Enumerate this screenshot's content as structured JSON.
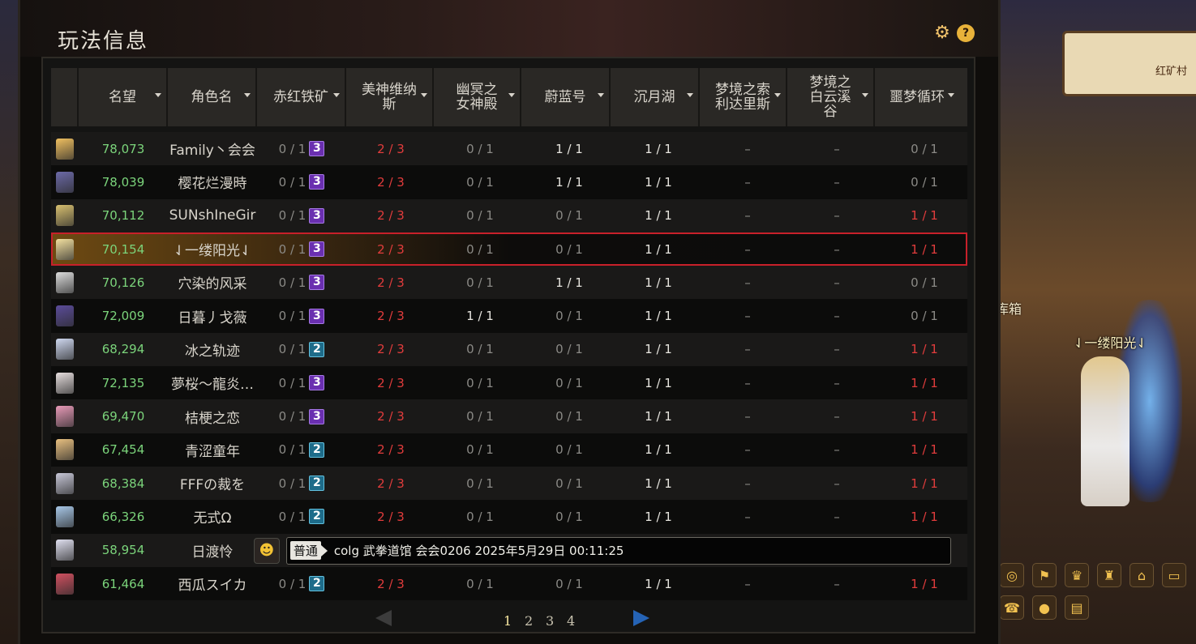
{
  "panel": {
    "title": "玩法信息",
    "settings_icon": "gear-icon",
    "help_icon": "help-icon",
    "help_label": "?"
  },
  "columns": [
    {
      "label": "名望",
      "sortable": true
    },
    {
      "label": "角色名",
      "sortable": true
    },
    {
      "label": "赤红铁矿",
      "sortable": true
    },
    {
      "label": "美神维纳斯",
      "sortable": true
    },
    {
      "label": "幽冥之女神殿",
      "sortable": true
    },
    {
      "label": "蔚蓝号",
      "sortable": true
    },
    {
      "label": "沉月湖",
      "sortable": true
    },
    {
      "label": "梦境之索利达里斯",
      "sortable": true
    },
    {
      "label": "梦境之白云溪谷",
      "sortable": true
    },
    {
      "label": "噩梦循环",
      "sortable": true
    }
  ],
  "rows": [
    {
      "fame": "78,073",
      "name": "Family丶会会",
      "iron": "0 / 1",
      "iron_badge": "3",
      "iron_badge_color": "purple",
      "venus": "2 / 3",
      "nether": "0 / 1",
      "azure": "1 / 1",
      "azure_color": "white",
      "moon": "1 / 1",
      "sol": "–",
      "cloud": "–",
      "nightmare": "0 / 1",
      "nightmare_color": "grey",
      "avatar_color": "#f0c060"
    },
    {
      "fame": "78,039",
      "name": "樱花烂漫時",
      "iron": "0 / 1",
      "iron_badge": "3",
      "iron_badge_color": "purple",
      "venus": "2 / 3",
      "nether": "0 / 1",
      "azure": "1 / 1",
      "azure_color": "white",
      "moon": "1 / 1",
      "sol": "–",
      "cloud": "–",
      "nightmare": "0 / 1",
      "nightmare_color": "grey",
      "avatar_color": "#6c6aa8"
    },
    {
      "fame": "70,112",
      "name": "SUNshΙneGir",
      "iron": "0 / 1",
      "iron_badge": "3",
      "iron_badge_color": "purple",
      "venus": "2 / 3",
      "nether": "0 / 1",
      "azure": "0 / 1",
      "azure_color": "grey",
      "moon": "1 / 1",
      "sol": "–",
      "cloud": "–",
      "nightmare": "1 / 1",
      "nightmare_color": "red",
      "avatar_color": "#d8c070"
    },
    {
      "fame": "70,154",
      "name": "⇃一缕阳光⇃",
      "iron": "0 / 1",
      "iron_badge": "3",
      "iron_badge_color": "purple",
      "venus": "2 / 3",
      "nether": "0 / 1",
      "azure": "0 / 1",
      "azure_color": "grey",
      "moon": "1 / 1",
      "sol": "–",
      "cloud": "–",
      "nightmare": "1 / 1",
      "nightmare_color": "red",
      "avatar_color": "#f3e0a0",
      "selected": true
    },
    {
      "fame": "70,126",
      "name": "穴染的风采",
      "iron": "0 / 1",
      "iron_badge": "3",
      "iron_badge_color": "purple",
      "venus": "2 / 3",
      "nether": "0 / 1",
      "azure": "1 / 1",
      "azure_color": "white",
      "moon": "1 / 1",
      "sol": "–",
      "cloud": "–",
      "nightmare": "0 / 1",
      "nightmare_color": "grey",
      "avatar_color": "#dcdcdc"
    },
    {
      "fame": "72,009",
      "name": "日暮丿戈薇",
      "iron": "0 / 1",
      "iron_badge": "3",
      "iron_badge_color": "purple",
      "venus": "2 / 3",
      "nether": "1 / 1",
      "nether_color": "white",
      "azure": "0 / 1",
      "azure_color": "grey",
      "moon": "1 / 1",
      "sol": "–",
      "cloud": "–",
      "nightmare": "0 / 1",
      "nightmare_color": "grey",
      "avatar_color": "#5b4c9a"
    },
    {
      "fame": "68,294",
      "name": "冰之轨迹",
      "iron": "0 / 1",
      "iron_badge": "2",
      "iron_badge_color": "blue",
      "venus": "2 / 3",
      "nether": "0 / 1",
      "azure": "0 / 1",
      "azure_color": "grey",
      "moon": "1 / 1",
      "sol": "–",
      "cloud": "–",
      "nightmare": "1 / 1",
      "nightmare_color": "red",
      "avatar_color": "#cfd8f0"
    },
    {
      "fame": "72,135",
      "name": "夢桜～龍炎…",
      "iron": "0 / 1",
      "iron_badge": "3",
      "iron_badge_color": "purple",
      "venus": "2 / 3",
      "nether": "0 / 1",
      "azure": "0 / 1",
      "azure_color": "grey",
      "moon": "1 / 1",
      "sol": "–",
      "cloud": "–",
      "nightmare": "1 / 1",
      "nightmare_color": "red",
      "avatar_color": "#e6dede"
    },
    {
      "fame": "69,470",
      "name": "桔梗之恋",
      "iron": "0 / 1",
      "iron_badge": "3",
      "iron_badge_color": "purple",
      "venus": "2 / 3",
      "nether": "0 / 1",
      "azure": "0 / 1",
      "azure_color": "grey",
      "moon": "1 / 1",
      "sol": "–",
      "cloud": "–",
      "nightmare": "1 / 1",
      "nightmare_color": "red",
      "avatar_color": "#e89ab8"
    },
    {
      "fame": "67,454",
      "name": "青涩童年",
      "iron": "0 / 1",
      "iron_badge": "2",
      "iron_badge_color": "blue",
      "venus": "2 / 3",
      "nether": "0 / 1",
      "azure": "0 / 1",
      "azure_color": "grey",
      "moon": "1 / 1",
      "sol": "–",
      "cloud": "–",
      "nightmare": "1 / 1",
      "nightmare_color": "red",
      "avatar_color": "#e8c080"
    },
    {
      "fame": "68,384",
      "name": "FFFの裁を",
      "iron": "0 / 1",
      "iron_badge": "2",
      "iron_badge_color": "blue",
      "venus": "2 / 3",
      "nether": "0 / 1",
      "azure": "0 / 1",
      "azure_color": "grey",
      "moon": "1 / 1",
      "sol": "–",
      "cloud": "–",
      "nightmare": "1 / 1",
      "nightmare_color": "red",
      "avatar_color": "#c8c8d8"
    },
    {
      "fame": "66,326",
      "name": "无式Ω",
      "iron": "0 / 1",
      "iron_badge": "2",
      "iron_badge_color": "blue",
      "venus": "2 / 3",
      "nether": "0 / 1",
      "azure": "0 / 1",
      "azure_color": "grey",
      "moon": "1 / 1",
      "sol": "–",
      "cloud": "–",
      "nightmare": "1 / 1",
      "nightmare_color": "red",
      "avatar_color": "#a8c8e8"
    },
    {
      "fame": "58,954",
      "name": "日渡怜",
      "chat_row": true,
      "avatar_color": "#e0e0f0"
    },
    {
      "fame": "61,464",
      "name": "西瓜スイカ",
      "iron": "0 / 1",
      "iron_badge": "2",
      "iron_badge_color": "blue",
      "venus": "2 / 3",
      "nether": "0 / 1",
      "azure": "0 / 1",
      "azure_color": "grey",
      "moon": "1 / 1",
      "sol": "–",
      "cloud": "–",
      "nightmare": "1 / 1",
      "nightmare_color": "red",
      "avatar_color": "#d05060"
    }
  ],
  "chat": {
    "emoji_icon": "smiley-icon",
    "tag": "普通",
    "message": "colg 武拳道馆 会会0206 2025年5月29日 00:11:25"
  },
  "pagination": {
    "pages": [
      "1",
      "2",
      "3",
      "4"
    ],
    "current": "1",
    "prev_icon": "prev-arrow-icon",
    "next_icon": "next-arrow-icon"
  },
  "scene": {
    "location": "红矿村",
    "player_name": "⇃一缕阳光⇃",
    "box_label": "库箱",
    "badge_alert": "!"
  },
  "colors": {
    "fame_green": "#7bd47b",
    "red_value": "#e23c3c",
    "badge_purple": "#6a2fb0",
    "badge_blue": "#1e6c8a",
    "selected_border": "#c8202a"
  }
}
